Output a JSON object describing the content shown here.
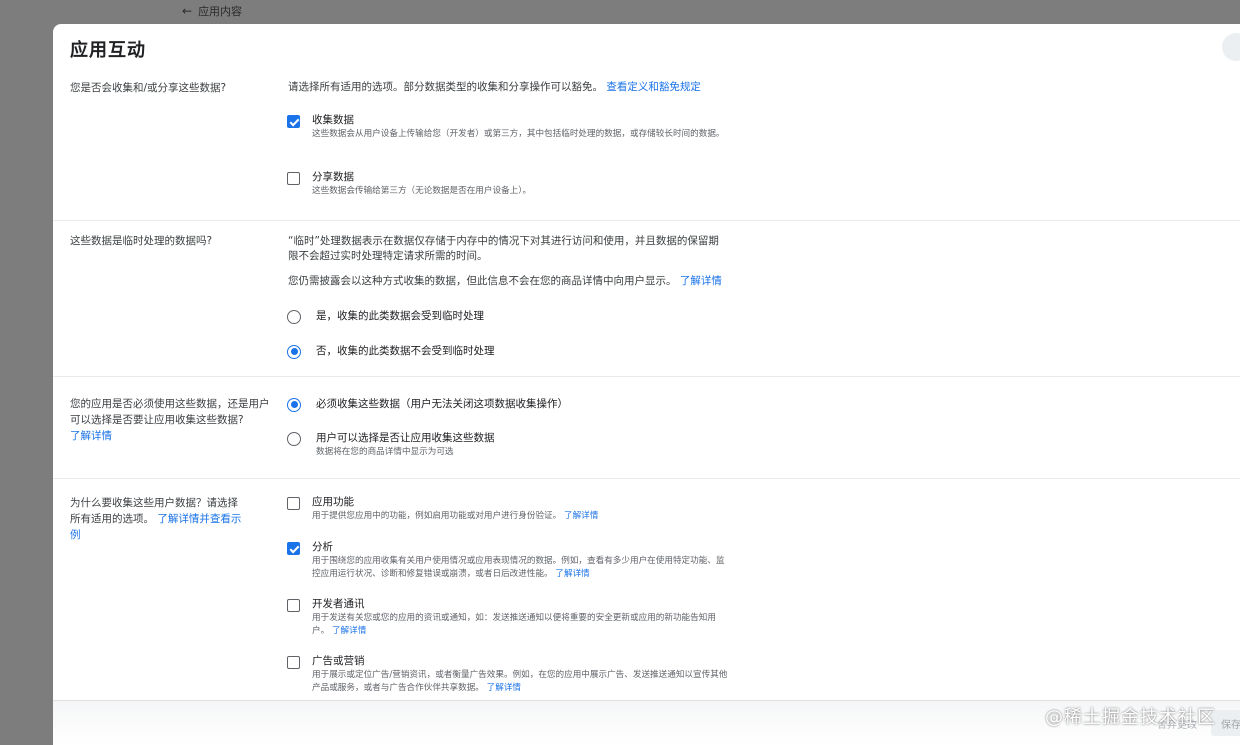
{
  "topbar": {
    "back_label": "应用内容"
  },
  "dialog": {
    "title": "应用互动",
    "q1": {
      "question": "您是否会收集和/或分享这些数据?",
      "intro": "请选择所有适用的选项。部分数据类型的收集和分享操作可以豁免。",
      "intro_link": "查看定义和豁免规定",
      "options": [
        {
          "label": "收集数据",
          "desc": "这些数据会从用户设备上传输给您（开发者）或第三方，其中包括临时处理的数据，或存储较长时间的数据。",
          "checked": true
        },
        {
          "label": "分享数据",
          "desc": "这些数据会传输给第三方（无论数据是否在用户设备上）。",
          "checked": false
        }
      ]
    },
    "q2": {
      "question": "这些数据是临时处理的数据吗?",
      "para1": "“临时”处理数据表示在数据仅存储于内存中的情况下对其进行访问和使用，并且数据的保留期限不会超过实时处理特定请求所需的时间。",
      "para2": "您仍需披露会以这种方式收集的数据，但此信息不会在您的商品详情中向用户显示。",
      "para2_link": "了解详情",
      "options": [
        {
          "label": "是，收集的此类数据会受到临时处理",
          "selected": false
        },
        {
          "label": "否，收集的此类数据不会受到临时处理",
          "selected": true
        }
      ]
    },
    "q3": {
      "question": "您的应用是否必须使用这些数据，还是用户可以选择是否要让应用收集这些数据?",
      "link": "了解详情",
      "options": [
        {
          "label": "必须收集这些数据（用户无法关闭这项数据收集操作）",
          "desc": "",
          "selected": true
        },
        {
          "label": "用户可以选择是否让应用收集这些数据",
          "desc": "数据将在您的商品详情中显示为可选",
          "selected": false
        }
      ]
    },
    "q4": {
      "question": "为什么要收集这些用户数据？请选择所有适用的选项。",
      "link": "了解详情并查看示例",
      "options": [
        {
          "label": "应用功能",
          "desc": "用于提供您应用中的功能，例如启用功能或对用户进行身份验证。",
          "link": "了解详情",
          "checked": false
        },
        {
          "label": "分析",
          "desc": "用于围绕您的应用收集有关用户使用情况或应用表现情况的数据。例如，查看有多少用户在使用特定功能、监控应用运行状况、诊断和修复错误或崩溃，或者日后改进性能。",
          "link": "了解详情",
          "checked": true
        },
        {
          "label": "开发者通讯",
          "desc": "用于发送有关您或您的应用的资讯或通知，如：发送推送通知以便将重要的安全更新或应用的新功能告知用户。",
          "link": "了解详情",
          "checked": false
        },
        {
          "label": "广告或营销",
          "desc": "用于展示或定位广告/营销资讯，或者衡量广告效果。例如，在您的应用中展示广告、发送推送通知以宣传其他产品或服务，或者与广告合作伙伴共享数据。",
          "link": "了解详情",
          "checked": false
        }
      ]
    }
  },
  "footer": {
    "discard_label": "舍弃更改",
    "save_label": "保存"
  },
  "watermark": "@稀土掘金技术社区",
  "colors": {
    "accent": "#1a73e8",
    "overlay": "#7d7d7d"
  }
}
